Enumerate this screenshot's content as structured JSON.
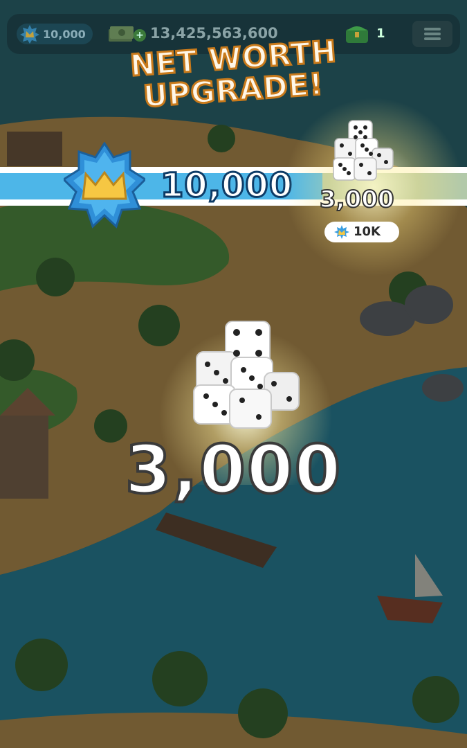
{
  "top_bar": {
    "net_worth": "10,000",
    "cash": "13,425,563,600",
    "chest_count": "1"
  },
  "title": {
    "line1": "NET WORTH",
    "line2": "UPGRADE!"
  },
  "progress": {
    "value": "10,000",
    "fill_fraction": 0.69
  },
  "next_reward": {
    "amount": "3,000",
    "requirement": "10K"
  },
  "reward": {
    "amount": "3,000"
  },
  "colors": {
    "bar_fill": "#4db6e8",
    "badge": "#3aa3e8",
    "badge_m": "#f6c743",
    "title_outline": "#c97a1b"
  },
  "icons": [
    "net-worth-badge-icon",
    "cash-stack-icon",
    "plus-icon",
    "chest-icon",
    "menu-icon",
    "dice-icon"
  ]
}
